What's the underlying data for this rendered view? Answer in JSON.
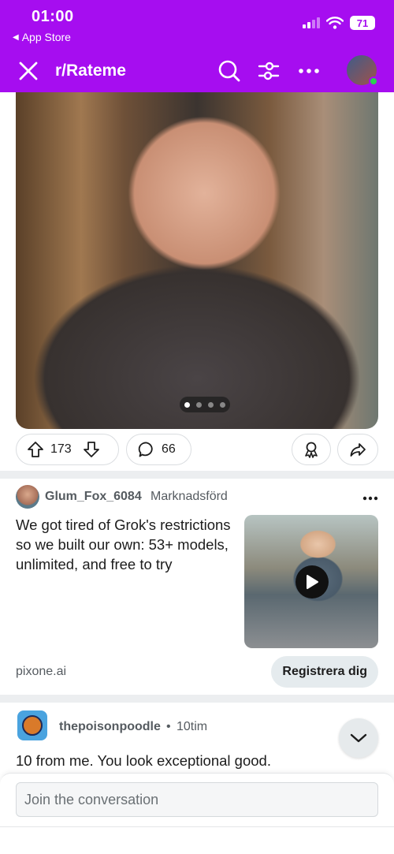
{
  "status_bar": {
    "time": "01:00",
    "back_label": "App Store",
    "battery": "71"
  },
  "header": {
    "subreddit": "r/Rateme"
  },
  "post": {
    "image_alt": "photo",
    "carousel_pages": 4,
    "carousel_active": 1,
    "upvotes": "173",
    "comments": "66"
  },
  "ad": {
    "username": "Glum_Fox_6084",
    "tag": "Marknadsförd",
    "text": "We got tired of Grok's restrictions so we built our own: 53+ models, unlimited, and free to try",
    "domain": "pixone.ai",
    "cta": "Registrera dig"
  },
  "comment": {
    "username": "thepoisonpoodle",
    "separator": "•",
    "time": "10tim",
    "text": "10 from me. You look exceptional good."
  },
  "composer": {
    "placeholder": "Join the conversation"
  },
  "colors": {
    "brand": "#a60df0",
    "online": "#2ad14f"
  }
}
